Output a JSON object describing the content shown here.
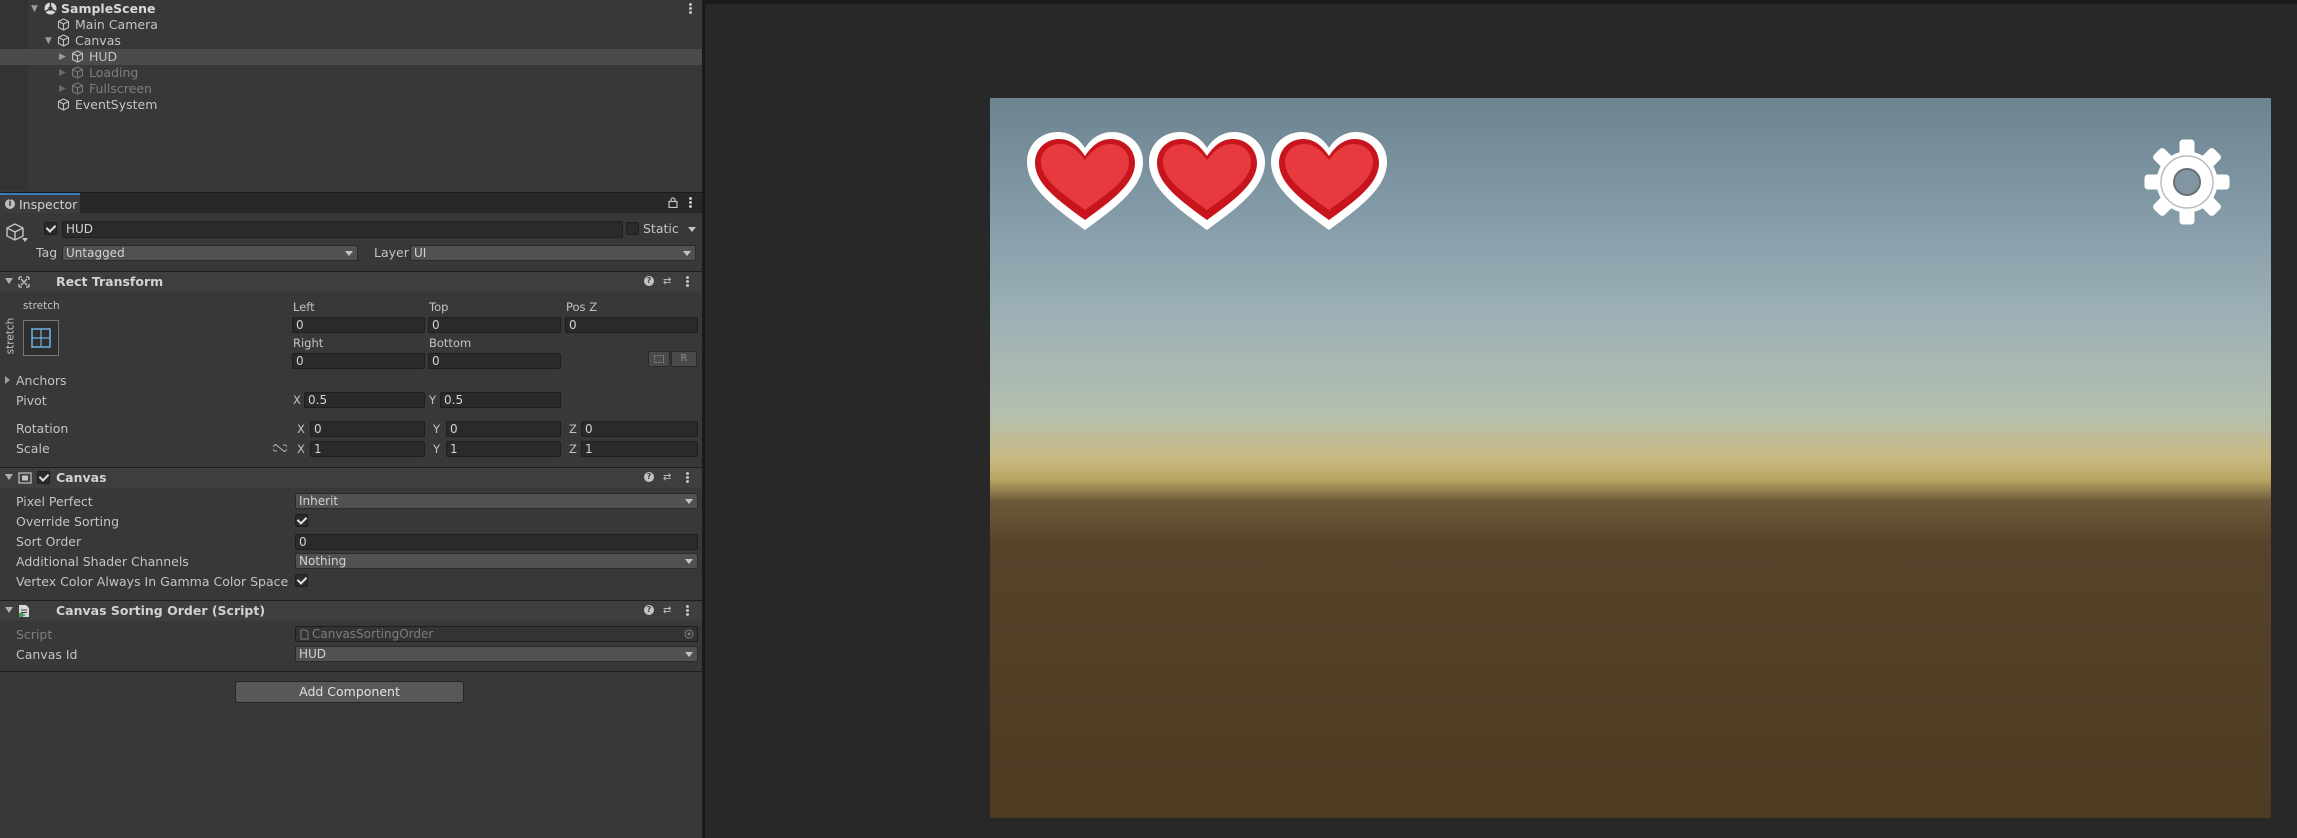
{
  "hierarchy": {
    "items": [
      {
        "label": "SampleScene",
        "kind": "scene"
      },
      {
        "label": "Main Camera",
        "kind": "object"
      },
      {
        "label": "Canvas",
        "kind": "object"
      },
      {
        "label": "HUD",
        "kind": "object",
        "selected": true
      },
      {
        "label": "Loading",
        "kind": "object",
        "disabled": true
      },
      {
        "label": "Fullscreen",
        "kind": "object",
        "disabled": true
      },
      {
        "label": "EventSystem",
        "kind": "object"
      }
    ]
  },
  "inspector": {
    "tab_label": "Inspector",
    "object": {
      "active": true,
      "name": "HUD",
      "static_label": "Static",
      "static": false,
      "tag_label": "Tag",
      "tag_value": "Untagged",
      "layer_label": "Layer",
      "layer_value": "UI"
    },
    "rect_transform": {
      "title": "Rect Transform",
      "anchor_preset_label": "stretch",
      "anchor_preset_side_label": "stretch",
      "left_label": "Left",
      "left": "0",
      "top_label": "Top",
      "top": "0",
      "posz_label": "Pos Z",
      "posz": "0",
      "right_label": "Right",
      "right": "0",
      "bottom_label": "Bottom",
      "bottom": "0",
      "r_button": "R",
      "anchors_label": "Anchors",
      "pivot_label": "Pivot",
      "pivot_x": "0.5",
      "pivot_y": "0.5",
      "rotation_label": "Rotation",
      "rotation_x": "0",
      "rotation_y": "0",
      "rotation_z": "0",
      "scale_label": "Scale",
      "scale_x": "1",
      "scale_y": "1",
      "scale_z": "1",
      "axis_x": "X",
      "axis_y": "Y",
      "axis_z": "Z"
    },
    "canvas": {
      "title": "Canvas",
      "enabled": true,
      "pixel_perfect_label": "Pixel Perfect",
      "pixel_perfect": "Inherit",
      "override_sorting_label": "Override Sorting",
      "override_sorting": true,
      "sort_order_label": "Sort Order",
      "sort_order": "0",
      "shader_channels_label": "Additional Shader Channels",
      "shader_channels": "Nothing",
      "vertex_color_label": "Vertex Color Always In Gamma Color Space",
      "vertex_color": true
    },
    "sorting_script": {
      "title": "Canvas Sorting Order (Script)",
      "script_label": "Script",
      "script_value": "CanvasSortingOrder",
      "canvas_id_label": "Canvas Id",
      "canvas_id": "HUD"
    },
    "add_component_label": "Add Component"
  },
  "game_view": {
    "hearts": 3,
    "settings_icon": "gear-icon",
    "heart_icon": "heart-icon"
  },
  "colors": {
    "accent": "#3a79bb",
    "heart_red": "#e0252c",
    "panel": "#383838",
    "sky_top": "#6c8390",
    "horizon": "#c9bb84",
    "ground": "#4d3b22"
  }
}
